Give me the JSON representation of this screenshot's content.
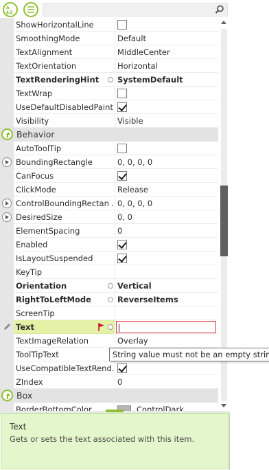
{
  "toolbar": {
    "categorized_icon": "categorized-sort-icon",
    "alphabetical_icon": "alphabetical-sort-icon",
    "search_value": "",
    "search_icon": "magnifier-icon"
  },
  "rows": [
    {
      "name": "ShowHorizontalLine",
      "type": "check",
      "checked": false
    },
    {
      "name": "SmoothingMode",
      "value": "Default"
    },
    {
      "name": "TextAlignment",
      "value": "MiddleCenter"
    },
    {
      "name": "TextOrientation",
      "value": "Horizontal"
    },
    {
      "name": "TextRenderingHint",
      "value": "SystemDefault",
      "bold": true,
      "reset": true
    },
    {
      "name": "TextWrap",
      "type": "check",
      "checked": false
    },
    {
      "name": "UseDefaultDisabledPaint",
      "type": "check",
      "checked": true
    },
    {
      "name": "Visibility",
      "value": "Visible"
    },
    {
      "group": "Behavior"
    },
    {
      "name": "AutoToolTip",
      "type": "check",
      "checked": false
    },
    {
      "name": "BoundingRectangle",
      "value": "0, 0, 0, 0",
      "expander": true
    },
    {
      "name": "CanFocus",
      "type": "check",
      "checked": true
    },
    {
      "name": "ClickMode",
      "value": "Release"
    },
    {
      "name": "ControlBoundingRectan ...",
      "value": "0, 0, 0, 0",
      "expander": true
    },
    {
      "name": "DesiredSize",
      "value": "0, 0",
      "expander": true
    },
    {
      "name": "ElementSpacing",
      "value": "0"
    },
    {
      "name": "Enabled",
      "type": "check",
      "checked": true
    },
    {
      "name": "IsLayoutSuspended",
      "type": "check",
      "checked": true
    },
    {
      "name": "KeyTip",
      "value": ""
    },
    {
      "name": "Orientation",
      "value": "Vertical",
      "bold": true,
      "reset": true
    },
    {
      "name": "RightToLeftMode",
      "value": "ReverseItems",
      "bold": true,
      "reset": true
    },
    {
      "name": "ScreenTip",
      "value": ""
    },
    {
      "name": "Text",
      "type": "edit",
      "value": "",
      "bold": true,
      "selected": true,
      "reset": true,
      "error": true
    },
    {
      "name": "TextImageRelation",
      "value": "Overlay"
    },
    {
      "name": "ToolTipText",
      "value": ""
    },
    {
      "name": "UseCompatibleTextRend...",
      "type": "check",
      "checked": true
    },
    {
      "name": "ZIndex",
      "value": "0"
    },
    {
      "group": "Box"
    },
    {
      "name": "BorderBottomColor",
      "value": "ControlDark",
      "swatch": "#b5b5b5"
    }
  ],
  "tooltip": "String value must not be an empty string!",
  "help": {
    "title": "Text",
    "description": "Gets or sets the text associated with this item."
  },
  "scroll": {
    "position_fraction": 0.42,
    "visible_fraction": 0.19
  },
  "colors": {
    "accent": "#8dbf2e",
    "selected": "#e4f1a6",
    "error": "#d9323a",
    "help_bg": "#e4f7cc"
  }
}
